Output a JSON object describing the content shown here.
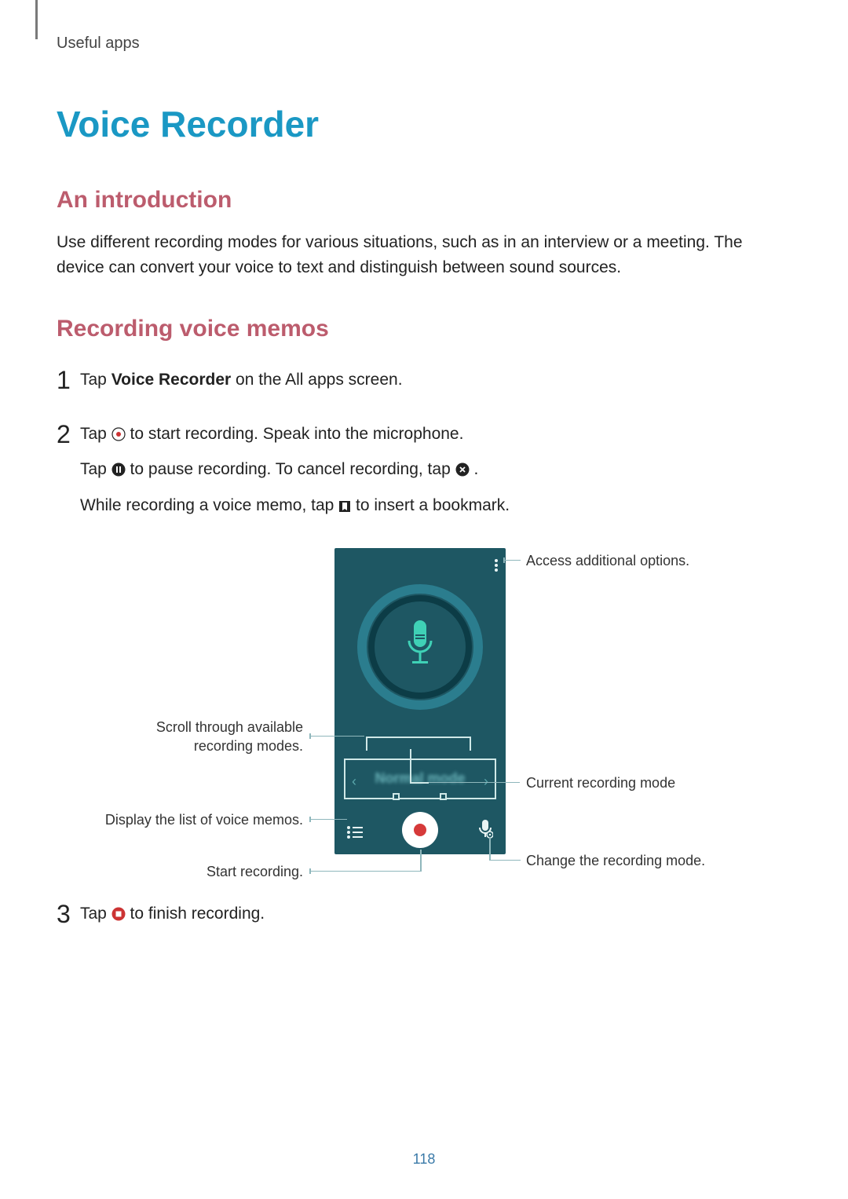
{
  "breadcrumb": "Useful apps",
  "title": "Voice Recorder",
  "section_intro_heading": "An introduction",
  "intro_text": "Use different recording modes for various situations, such as in an interview or a meeting. The device can convert your voice to text and distinguish between sound sources.",
  "section_memos_heading": "Recording voice memos",
  "step1": {
    "num": "1",
    "prefix": "Tap ",
    "bold": "Voice Recorder",
    "suffix": " on the All apps screen."
  },
  "step2": {
    "num": "2",
    "line1_a": "Tap ",
    "line1_b": " to start recording. Speak into the microphone.",
    "line2_a": "Tap ",
    "line2_b": " to pause recording. To cancel recording, tap ",
    "line2_c": ".",
    "line3_a": "While recording a voice memo, tap ",
    "line3_b": " to insert a bookmark."
  },
  "step3": {
    "num": "3",
    "a": "Tap ",
    "b": " to finish recording."
  },
  "phone": {
    "mode_label": "Normal mode"
  },
  "callouts": {
    "options": "Access additional options.",
    "scroll_a": "Scroll through available",
    "scroll_b": "recording modes.",
    "current": "Current recording mode",
    "list": "Display the list of voice memos.",
    "start": "Start recording.",
    "change": "Change the recording mode."
  },
  "page_number": "118"
}
